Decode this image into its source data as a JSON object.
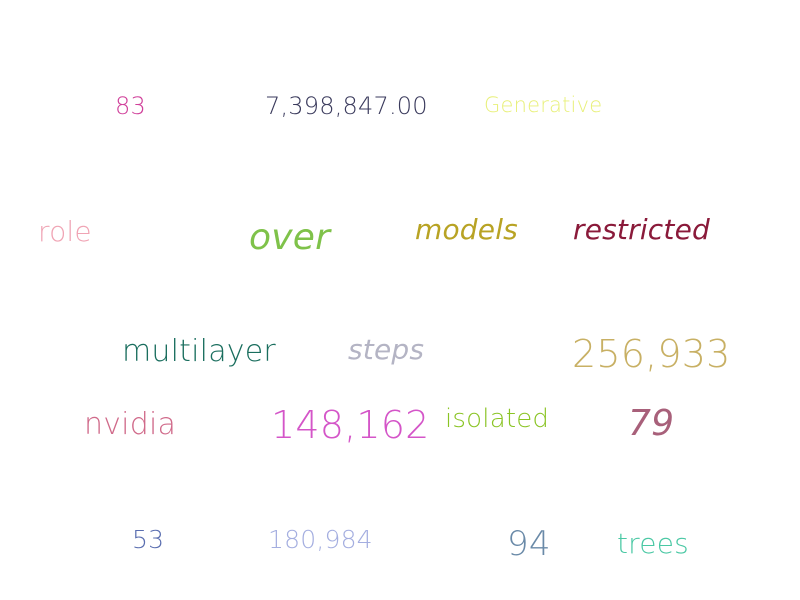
{
  "words": {
    "w83": {
      "text": "83",
      "color": "#d0409a"
    },
    "w7398847": {
      "text": "7,398,847.00",
      "color": "#3a3a5c"
    },
    "generative": {
      "text": "Generative",
      "color": "#e8f07a"
    },
    "role": {
      "text": "role",
      "color": "#f0a4b4"
    },
    "over": {
      "text": "over",
      "color": "#7fc24a"
    },
    "models": {
      "text": "models",
      "color": "#b8a324"
    },
    "restricted": {
      "text": "restricted",
      "color": "#8a1a3a"
    },
    "multilayer": {
      "text": "multilayer",
      "color": "#1a6e5e"
    },
    "steps": {
      "text": "steps",
      "color": "#b4b4c4"
    },
    "w256933": {
      "text": "256,933",
      "color": "#c8b064"
    },
    "nvidia": {
      "text": "nvidia",
      "color": "#d06a8a"
    },
    "w148162": {
      "text": "148,162",
      "color": "#d455c8"
    },
    "isolated": {
      "text": "isolated",
      "color": "#8ac424"
    },
    "w79": {
      "text": "79",
      "color": "#a8607a"
    },
    "w53": {
      "text": "53",
      "color": "#5a6eb0"
    },
    "w180984": {
      "text": "180,984",
      "color": "#a4aee0"
    },
    "w94": {
      "text": "94",
      "color": "#6a8aa8"
    },
    "trees": {
      "text": "trees",
      "color": "#4ac8a4"
    }
  }
}
